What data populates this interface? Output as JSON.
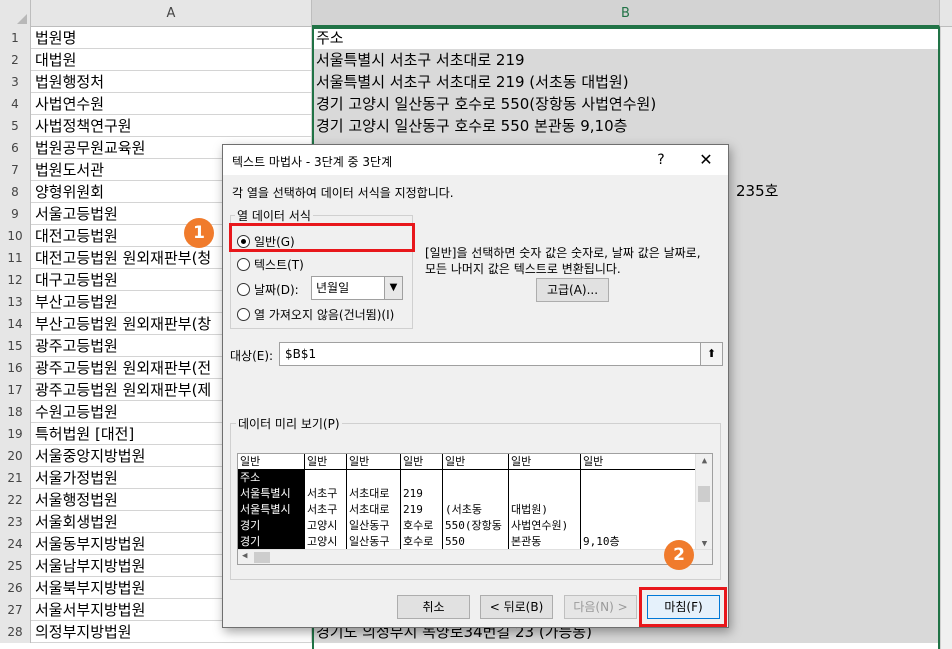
{
  "sheet": {
    "columns": [
      "A",
      "B"
    ],
    "rows": [
      {
        "n": "1",
        "a": "법원명",
        "b": "주소"
      },
      {
        "n": "2",
        "a": "대법원",
        "b": "서울특별시 서초구 서초대로 219"
      },
      {
        "n": "3",
        "a": "법원행정처",
        "b": "서울특별시 서초구 서초대로 219 (서초동 대법원)"
      },
      {
        "n": "4",
        "a": "사법연수원",
        "b": "경기 고양시 일산동구 호수로 550(장항동 사법연수원)"
      },
      {
        "n": "5",
        "a": "사법정책연구원",
        "b": "경기 고양시 일산동구 호수로 550 본관동 9,10층"
      },
      {
        "n": "6",
        "a": "법원공무원교육원",
        "b": ""
      },
      {
        "n": "7",
        "a": "법원도서관",
        "b": ""
      },
      {
        "n": "8",
        "a": "양형위원회",
        "b": ""
      },
      {
        "n": "9",
        "a": "서울고등법원",
        "b": ""
      },
      {
        "n": "10",
        "a": "대전고등법원",
        "b": ""
      },
      {
        "n": "11",
        "a": "대전고등법원 원외재판부(청",
        "b": ""
      },
      {
        "n": "12",
        "a": "대구고등법원",
        "b": ""
      },
      {
        "n": "13",
        "a": "부산고등법원",
        "b": ""
      },
      {
        "n": "14",
        "a": "부산고등법원 원외재판부(창",
        "b": ""
      },
      {
        "n": "15",
        "a": "광주고등법원",
        "b": ""
      },
      {
        "n": "16",
        "a": "광주고등법원 원외재판부(전",
        "b": ""
      },
      {
        "n": "17",
        "a": "광주고등법원 원외재판부(제",
        "b": ""
      },
      {
        "n": "18",
        "a": "수원고등법원",
        "b": ""
      },
      {
        "n": "19",
        "a": "특허법원 [대전]",
        "b": ""
      },
      {
        "n": "20",
        "a": "서울중앙지방법원",
        "b": ""
      },
      {
        "n": "21",
        "a": "서울가정법원",
        "b": ""
      },
      {
        "n": "22",
        "a": "서울행정법원",
        "b": ""
      },
      {
        "n": "23",
        "a": "서울회생법원",
        "b": ""
      },
      {
        "n": "24",
        "a": "서울동부지방법원",
        "b": ""
      },
      {
        "n": "25",
        "a": "서울남부지방법원",
        "b": ""
      },
      {
        "n": "26",
        "a": "서울북부지방법원",
        "b": ""
      },
      {
        "n": "27",
        "a": "서울서부지방법원",
        "b": ""
      },
      {
        "n": "28",
        "a": "의정부지방법원",
        "b": "경기도 의정부시 녹양로34번길 23 (가능동)"
      }
    ],
    "overlap_text": "235호"
  },
  "dialog": {
    "title": "텍스트 마법사 - 3단계 중 3단계",
    "help": "?",
    "close": "✕",
    "instruction": "각 열을 선택하여 데이터 서식을 지정합니다.",
    "group_label": "열 데이터 서식",
    "radio_general": "일반(G)",
    "radio_text": "텍스트(T)",
    "radio_date": "날짜(D):",
    "radio_skip": "열 가져오지 않음(건너뜀)(I)",
    "date_value": "년월일",
    "description_line1": "[일반]을 선택하면 숫자 값은 숫자로, 날짜 값은 날짜로,",
    "description_line2": "모든 나머지 값은 텍스트로 변환됩니다.",
    "advanced_button": "고급(A)...",
    "target_label": "대상(E):",
    "target_value": "$B$1",
    "preview_label": "데이터 미리 보기(P)",
    "preview_columns": [
      {
        "header": "일반",
        "values": [
          "주소",
          "서울특별시",
          "서울특별시",
          "경기",
          "경기"
        ]
      },
      {
        "header": "일반",
        "values": [
          "",
          "서초구",
          "서초구",
          "고양시",
          "고양시"
        ]
      },
      {
        "header": "일반",
        "values": [
          "",
          "서초대로",
          "서초대로",
          "일산동구",
          "일산동구"
        ]
      },
      {
        "header": "일반",
        "values": [
          "",
          "219",
          "219",
          "호수로",
          "호수로"
        ]
      },
      {
        "header": "일반",
        "values": [
          "",
          "",
          "(서초동",
          "550(장항동",
          "550"
        ]
      },
      {
        "header": "일반",
        "values": [
          "",
          "",
          "대법원)",
          "사법연수원)",
          "본관동"
        ]
      },
      {
        "header": "일반",
        "values": [
          "",
          "",
          "",
          "",
          "9,10층"
        ]
      }
    ],
    "cancel": "취소",
    "back": "< 뒤로(B)",
    "next": "다음(N) >",
    "finish": "마침(F)"
  },
  "annotations": {
    "badge1": "1",
    "badge2": "2"
  }
}
